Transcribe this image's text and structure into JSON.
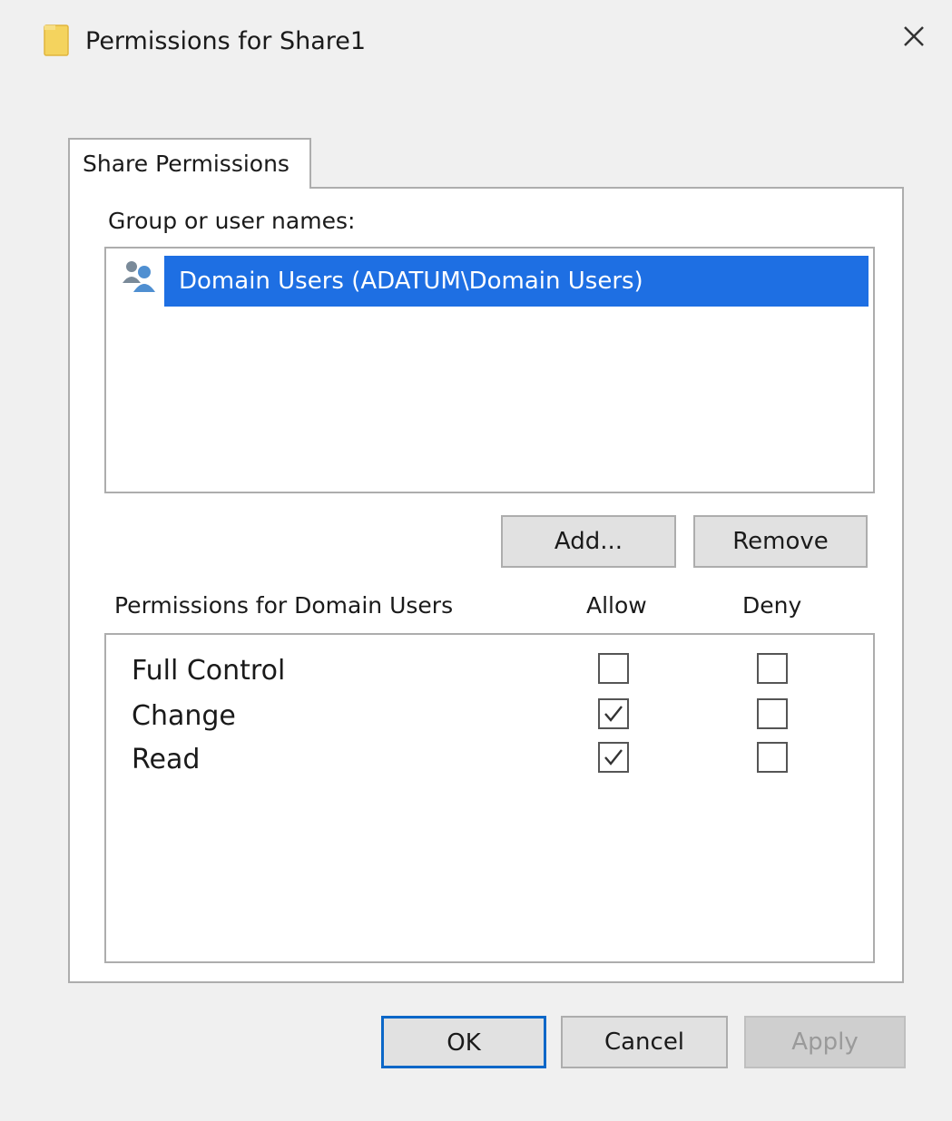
{
  "window": {
    "title": "Permissions for Share1",
    "close_icon": "close-icon"
  },
  "tabs": [
    {
      "label": "Share Permissions",
      "selected": true
    }
  ],
  "group_list": {
    "label": "Group or user names:",
    "items": [
      {
        "label": "Domain Users (ADATUM\\Domain Users)",
        "icon": "users-icon",
        "selected": true
      }
    ]
  },
  "buttons": {
    "add": "Add...",
    "remove": "Remove",
    "ok": "OK",
    "cancel": "Cancel",
    "apply": "Apply"
  },
  "permissions": {
    "header": "Permissions for Domain Users",
    "allow_header": "Allow",
    "deny_header": "Deny",
    "rows": [
      {
        "name": "Full Control",
        "allow": false,
        "deny": false
      },
      {
        "name": "Change",
        "allow": true,
        "deny": false
      },
      {
        "name": "Read",
        "allow": true,
        "deny": false
      }
    ]
  },
  "colors": {
    "selection": "#1e6fe3",
    "default_button_border": "#0b67c8",
    "folder": "#f4d35e"
  }
}
